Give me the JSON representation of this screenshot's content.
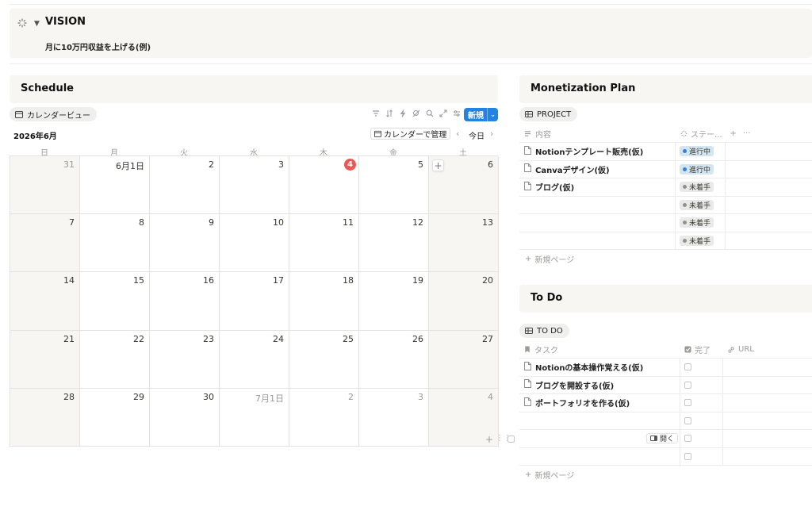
{
  "vision": {
    "title": "VISION",
    "subtitle": "月に10万円収益を上げる(例)"
  },
  "schedule": {
    "title": "Schedule",
    "view_label": "カレンダービュー",
    "new_label": "新規",
    "month": "2026年6月",
    "manage_label": "カレンダーで管理",
    "today_label": "今日",
    "weekdays": [
      "日",
      "月",
      "火",
      "水",
      "木",
      "金",
      "土"
    ],
    "days": [
      {
        "label": "31",
        "other": true
      },
      {
        "label": "6月1日"
      },
      {
        "label": "2"
      },
      {
        "label": "3"
      },
      {
        "label": "4",
        "today": true
      },
      {
        "label": "5"
      },
      {
        "label": "6",
        "add": true
      },
      {
        "label": "7"
      },
      {
        "label": "8"
      },
      {
        "label": "9"
      },
      {
        "label": "10"
      },
      {
        "label": "11"
      },
      {
        "label": "12"
      },
      {
        "label": "13"
      },
      {
        "label": "14"
      },
      {
        "label": "15"
      },
      {
        "label": "16"
      },
      {
        "label": "17"
      },
      {
        "label": "18"
      },
      {
        "label": "19"
      },
      {
        "label": "20"
      },
      {
        "label": "21"
      },
      {
        "label": "22"
      },
      {
        "label": "23"
      },
      {
        "label": "24"
      },
      {
        "label": "25"
      },
      {
        "label": "26"
      },
      {
        "label": "27"
      },
      {
        "label": "28"
      },
      {
        "label": "29"
      },
      {
        "label": "30"
      },
      {
        "label": "7月1日",
        "other": true
      },
      {
        "label": "2",
        "other": true
      },
      {
        "label": "3",
        "other": true
      },
      {
        "label": "4",
        "other": true
      }
    ],
    "add_symbol": "+"
  },
  "monetization": {
    "title": "Monetization Plan",
    "view_label": "PROJECT",
    "col_name": "内容",
    "col_status": "ステー...",
    "col_add": "+",
    "col_more": "···",
    "rows": [
      {
        "name": "Notionテンプレート販売(仮)",
        "status": "進行中",
        "kind": "progress"
      },
      {
        "name": "Canvaデザイン(仮)",
        "status": "進行中",
        "kind": "progress"
      },
      {
        "name": "ブログ(仮)",
        "status": "未着手",
        "kind": "todo"
      },
      {
        "name": "",
        "status": "未着手",
        "kind": "todo"
      },
      {
        "name": "",
        "status": "未着手",
        "kind": "todo"
      },
      {
        "name": "",
        "status": "未着手",
        "kind": "todo"
      }
    ],
    "new_page": "新規ページ",
    "colors": {
      "progress_bg": "#d3e5ef",
      "progress_dot": "#2f80ed",
      "todo_bg": "#e9e9e7",
      "todo_dot": "#91918e"
    }
  },
  "todo": {
    "title": "To Do",
    "view_label": "TO DO",
    "col_task": "タスク",
    "col_done": "完了",
    "col_url": "URL",
    "rows": [
      {
        "name": "Notionの基本操作覚える(仮)"
      },
      {
        "name": "ブログを開設する(仮)"
      },
      {
        "name": "ポートフォリオを作る(仮)"
      },
      {
        "name": ""
      },
      {
        "name": "",
        "open": "開く"
      },
      {
        "name": ""
      }
    ],
    "new_page": "新規ページ"
  }
}
